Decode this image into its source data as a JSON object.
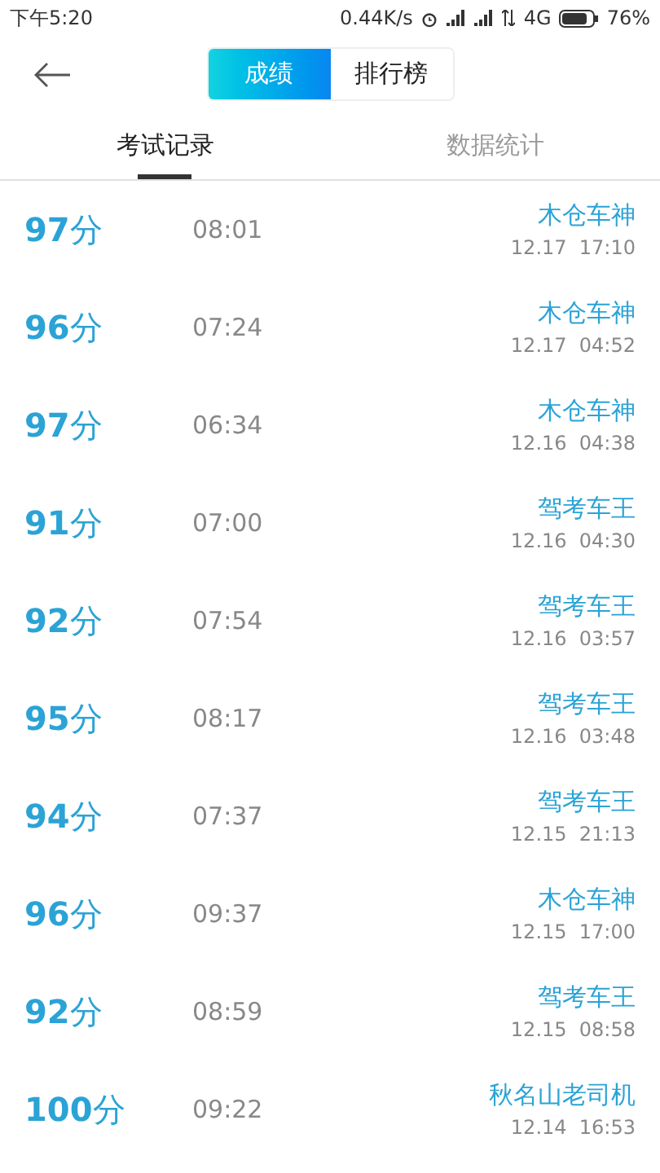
{
  "status_bar": {
    "time": "下午5:20",
    "speed": "0.44K/s",
    "network": "4G",
    "battery": "76%"
  },
  "segmented": [
    {
      "label": "成绩",
      "selected": true
    },
    {
      "label": "排行榜",
      "selected": false
    }
  ],
  "tabs": [
    {
      "label": "考试记录",
      "selected": true
    },
    {
      "label": "数据统计",
      "selected": false
    }
  ],
  "records": [
    {
      "score": "**97**分",
      "duration": "08:01",
      "name": "木仓车神",
      "date": "12.17  17:10"
    },
    {
      "score": "**96**分",
      "duration": "07:24",
      "name": "木仓车神",
      "date": "12.17  04:52"
    },
    {
      "score": "**97**分",
      "duration": "06:34",
      "name": "木仓车神",
      "date": "12.16  04:38"
    },
    {
      "score": "**91**分",
      "duration": "07:00",
      "name": "驾考车王",
      "date": "12.16  04:30"
    },
    {
      "score": "**92**分",
      "duration": "07:54",
      "name": "驾考车王",
      "date": "12.16  03:57"
    },
    {
      "score": "**95**分",
      "duration": "08:17",
      "name": "驾考车王",
      "date": "12.16  03:48"
    },
    {
      "score": "**94**分",
      "duration": "07:37",
      "name": "驾考车王",
      "date": "12.15  21:13"
    },
    {
      "score": "**96**分",
      "duration": "09:37",
      "name": "木仓车神",
      "date": "12.15  17:00"
    },
    {
      "score": "**92**分",
      "duration": "08:59",
      "name": "驾考车王",
      "date": "12.15  08:58"
    },
    {
      "score": "**100**分",
      "duration": "09:22",
      "name": "秋名山老司机",
      "date": "12.14  16:53"
    }
  ]
}
